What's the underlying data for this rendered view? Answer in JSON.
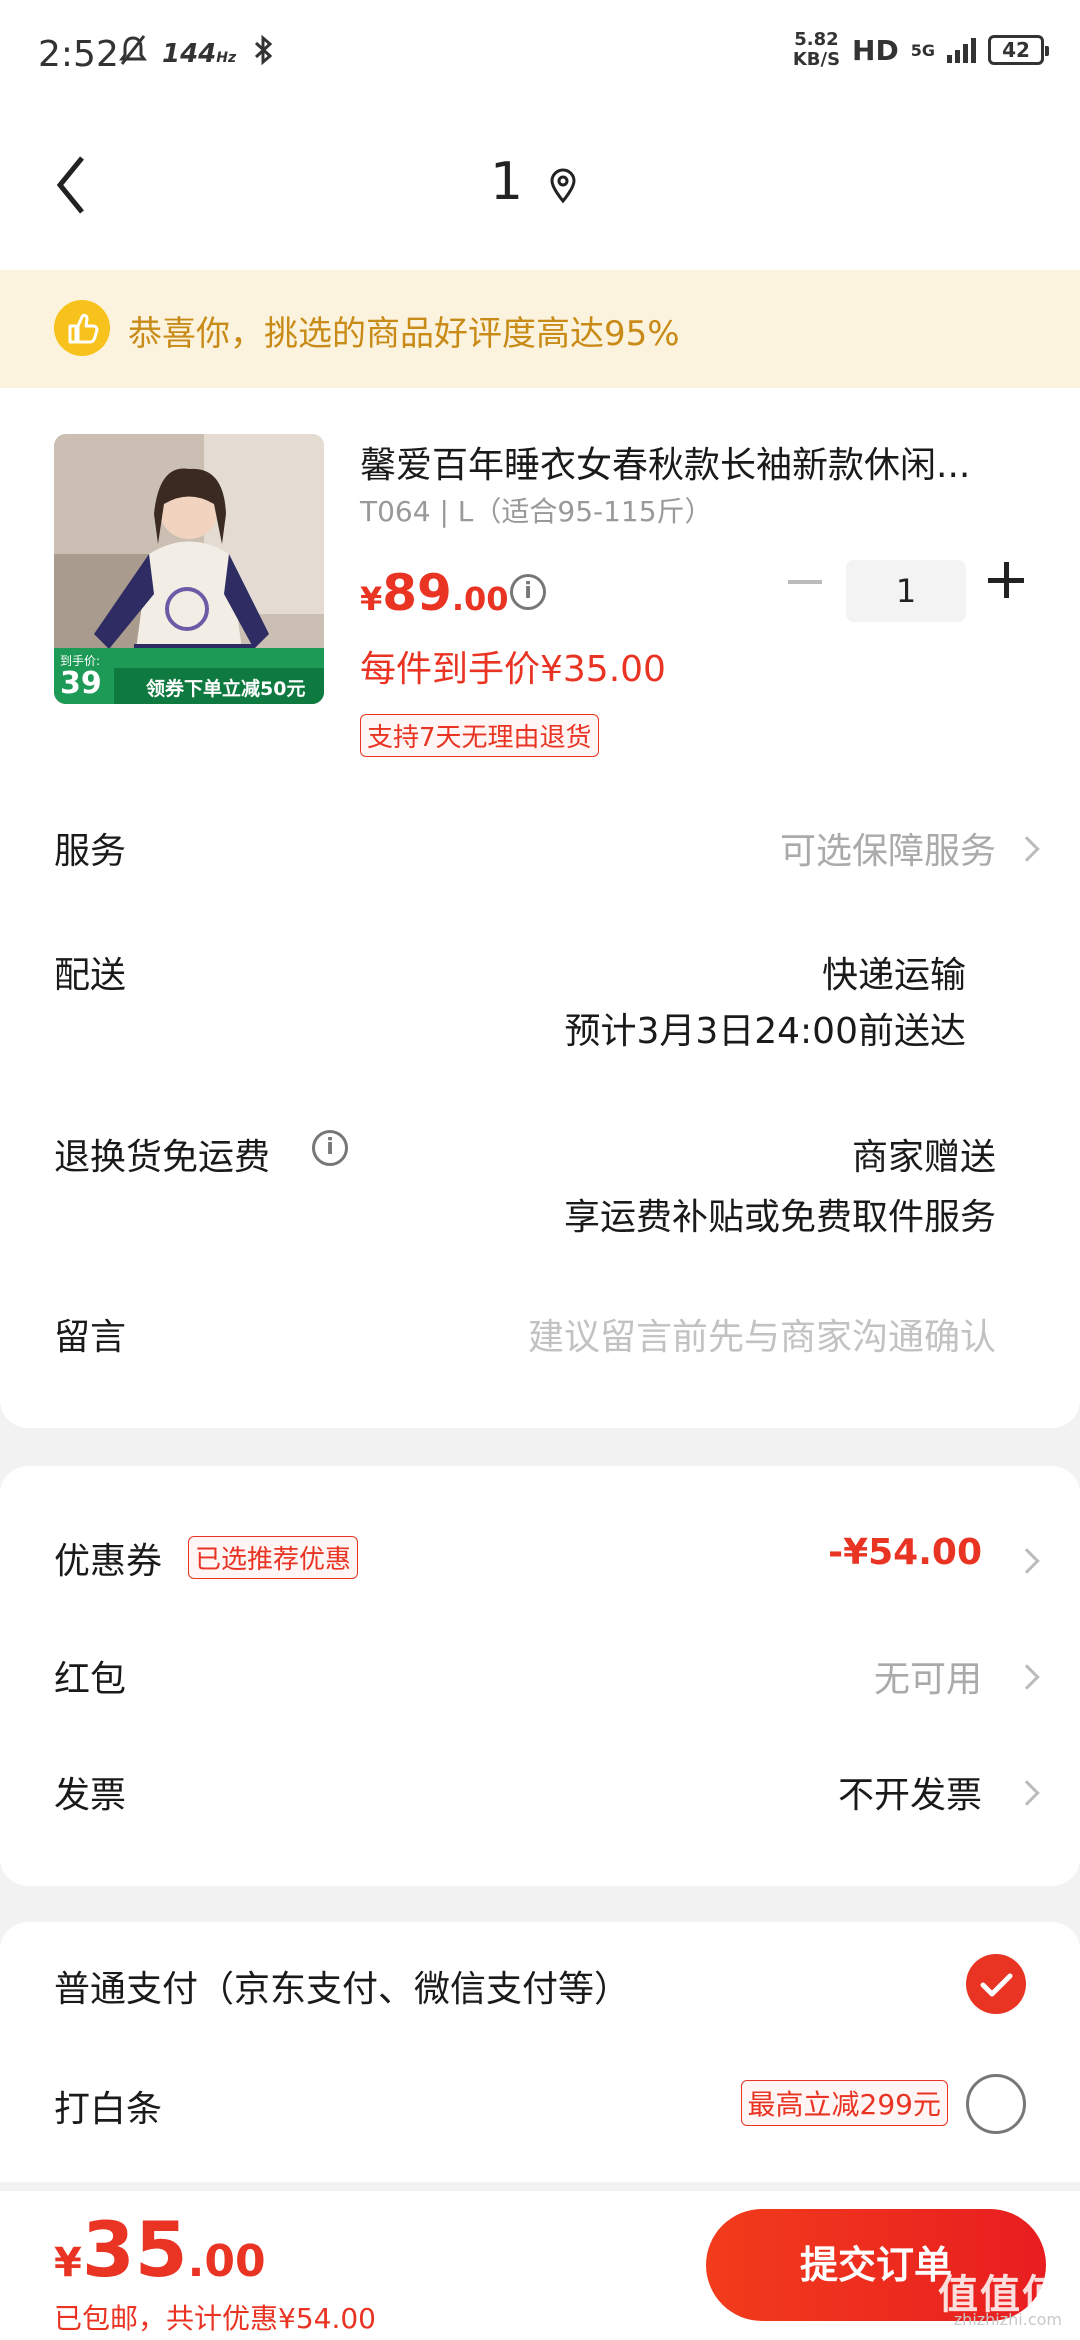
{
  "status_bar": {
    "time": "2:52",
    "refresh_rate": "144",
    "refresh_unit": "Hz",
    "net_speed_value": "5.82",
    "net_speed_unit": "KB/S",
    "hd": "HD",
    "network": "5G",
    "battery": "42"
  },
  "header": {
    "title": "1",
    "back_icon": "chevron-left-icon",
    "location_icon": "location-pin-icon"
  },
  "banner": {
    "icon": "thumbs-up-icon",
    "text": "恭喜你，挑选的商品好评度高达95%"
  },
  "product": {
    "name": "馨爱百年睡衣女春秋款长袖新款休闲...",
    "spec": "T064 | L（适合95-115斤）",
    "price_symbol": "¥",
    "price_int": "89",
    "price_dec": ".00",
    "quantity": "1",
    "per_item_price": "每件到手价¥35.00",
    "return_policy": "支持7天无理由退货",
    "image_badge_label": "到手价:",
    "image_badge_price": "39",
    "image_badge_promo": "领券下单立减50元"
  },
  "rows": {
    "service_label": "服务",
    "service_value": "可选保障服务",
    "delivery_label": "配送",
    "delivery_method": "快递运输",
    "delivery_eta": "预计3月3日24:00前送达",
    "return_shipping_label": "退换货免运费",
    "return_shipping_value1": "商家赠送",
    "return_shipping_value2": "享运费补贴或免费取件服务",
    "message_label": "留言",
    "message_placeholder": "建议留言前先与商家沟通确认"
  },
  "discounts": {
    "coupon_label": "优惠券",
    "coupon_tag": "已选推荐优惠",
    "coupon_value": "-¥54.00",
    "red_packet_label": "红包",
    "red_packet_value": "无可用",
    "invoice_label": "发票",
    "invoice_value": "不开发票"
  },
  "payment": {
    "normal_label": "普通支付（京东支付、微信支付等）",
    "baitiao_label": "打白条",
    "baitiao_tag": "最高立减299元"
  },
  "footer": {
    "total_symbol": "¥",
    "total_int": "35",
    "total_dec": ".00",
    "summary": "已包邮，共计优惠¥54.00",
    "submit_label": "提交订单",
    "watermark": "值值值",
    "watermark_sub": "zhizhizhi.com"
  },
  "colors": {
    "accent": "#e93323",
    "banner_bg": "#fcf3de",
    "banner_text": "#c98b17"
  }
}
